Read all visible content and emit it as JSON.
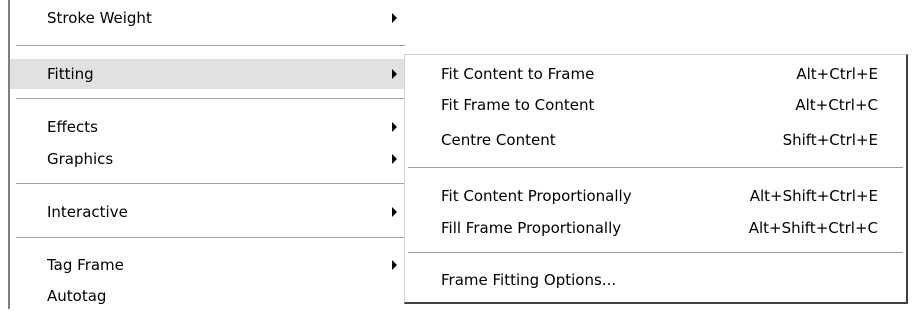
{
  "context_menu": {
    "items": [
      {
        "label": "Stroke Weight"
      },
      {
        "label": "Fitting"
      },
      {
        "label": "Effects"
      },
      {
        "label": "Graphics"
      },
      {
        "label": "Interactive"
      },
      {
        "label": "Tag Frame"
      },
      {
        "label": "Autotag"
      }
    ],
    "highlighted_item": "Fitting"
  },
  "fitting_submenu": {
    "items": [
      {
        "label": "Fit Content to Frame",
        "shortcut": "Alt+Ctrl+E"
      },
      {
        "label": "Fit Frame to Content",
        "shortcut": "Alt+Ctrl+C"
      },
      {
        "label": "Centre Content",
        "shortcut": "Shift+Ctrl+E"
      },
      {
        "label": "Fit Content Proportionally",
        "shortcut": "Alt+Shift+Ctrl+E"
      },
      {
        "label": "Fill Frame Proportionally",
        "shortcut": "Alt+Shift+Ctrl+C"
      },
      {
        "label": "Frame Fitting Options..."
      }
    ]
  },
  "colors": {
    "highlight_bg": "#e1e1e1",
    "separator": "#a0a0a0",
    "border_dark": "#404040"
  }
}
